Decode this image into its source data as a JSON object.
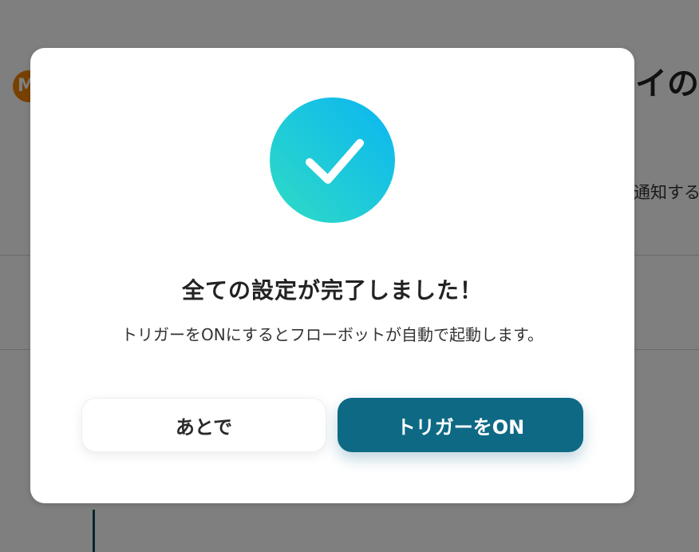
{
  "background": {
    "logo_text": "M",
    "title_fragment": "イの",
    "description_fragment": "通知する"
  },
  "modal": {
    "title": "全ての設定が完了しました！",
    "message": "トリガーをONにするとフローボットが自動で起動します。",
    "later_button_label": "あとで",
    "trigger_on_button_label": "トリガーをON"
  },
  "colors": {
    "primary_button": "#0e6985",
    "check_gradient_start": "#2fdcc4",
    "check_gradient_end": "#0bb5f2",
    "logo": "#f08300"
  },
  "icons": {
    "success": "check-circle-icon",
    "logo": "brand-logo-icon"
  }
}
